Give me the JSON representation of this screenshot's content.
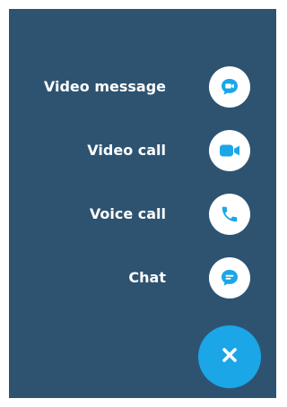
{
  "menu": {
    "items": [
      {
        "label": "Video message",
        "icon": "video-message-icon"
      },
      {
        "label": "Video call",
        "icon": "video-camera-icon"
      },
      {
        "label": "Voice call",
        "icon": "phone-icon"
      },
      {
        "label": "Chat",
        "icon": "chat-bubble-icon"
      }
    ],
    "close_icon": "close-icon"
  },
  "colors": {
    "panel_background": "#2e5371",
    "accent": "#1ba6e8",
    "label_text": "#ffffff",
    "small_button_background": "#ffffff"
  }
}
